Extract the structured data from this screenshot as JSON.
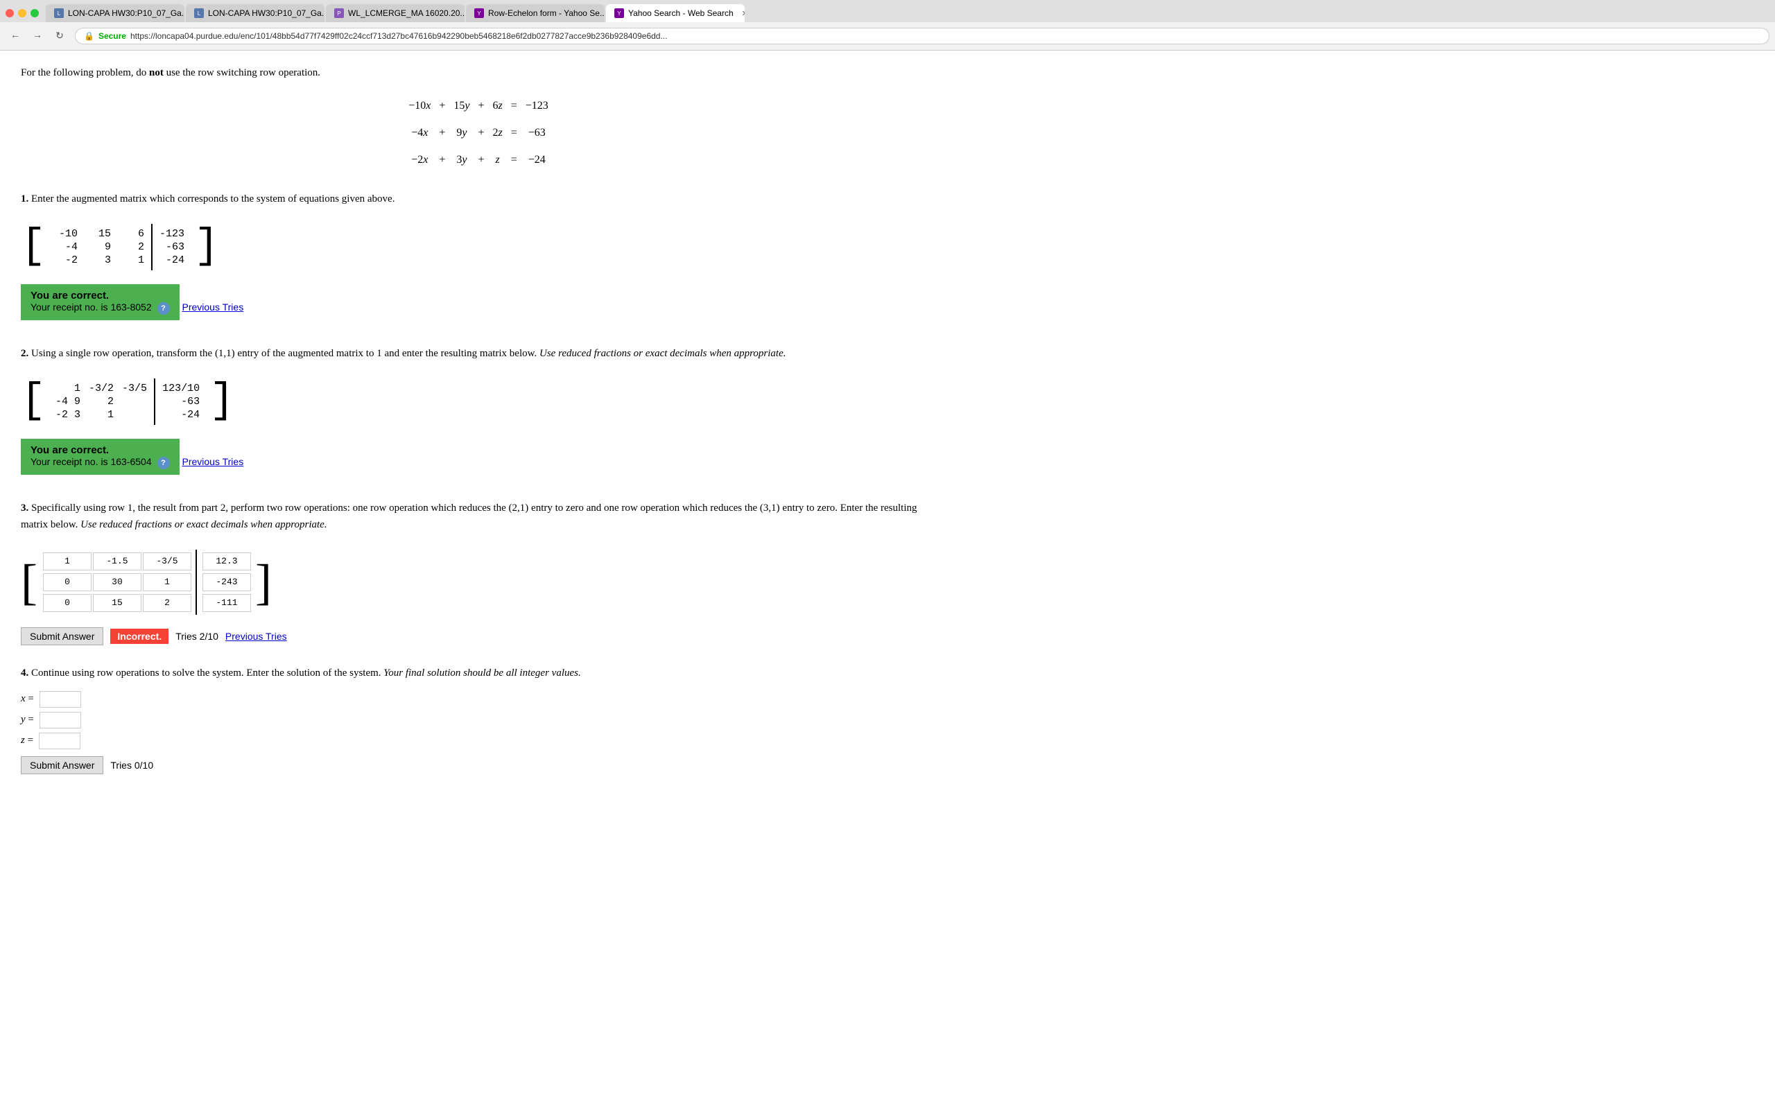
{
  "browser": {
    "tabs": [
      {
        "id": "tab1",
        "label": "LON-CAPA HW30:P10_07_Ga...",
        "active": false,
        "icon": "loncapa"
      },
      {
        "id": "tab2",
        "label": "LON-CAPA HW30:P10_07_Ga...",
        "active": false,
        "icon": "loncapa"
      },
      {
        "id": "tab3",
        "label": "WL_LCMERGE_MA 16020.20...",
        "active": false,
        "icon": "purple"
      },
      {
        "id": "tab4",
        "label": "Row-Echelon form - Yahoo Se...",
        "active": false,
        "icon": "yahoo"
      },
      {
        "id": "tab5",
        "label": "Yahoo Search - Web Search",
        "active": true,
        "icon": "yahoo"
      }
    ],
    "address": {
      "protocol": "Secure",
      "url": "https://loncapa04.purdue.edu/enc/101/48bb54d77f7429ff02c24ccf713d27bc47616b942290beb5468218e6f2db0277827acce9b236b928409e6dd..."
    }
  },
  "page": {
    "intro": "For the following problem, do not use the row switching row operation.",
    "system": {
      "eq1": [
        "-10x",
        "+",
        "15y",
        "+",
        "6z",
        "=",
        "-123"
      ],
      "eq2": [
        "-4x",
        "+",
        "9y",
        "+",
        "2z",
        "=",
        "-63"
      ],
      "eq3": [
        "-2x",
        "+",
        "3y",
        "+",
        "z",
        "=",
        "-24"
      ]
    },
    "q1": {
      "number": "1.",
      "text": "Enter the augmented matrix which corresponds to the system of equations given above.",
      "matrix": {
        "rows": [
          [
            "-10",
            "15",
            "6",
            "-123"
          ],
          [
            "-4",
            "9",
            "2",
            "-63"
          ],
          [
            "-2",
            "3",
            "1",
            "-24"
          ]
        ]
      },
      "status": "correct",
      "receipt": "Your receipt no. is 163-8052",
      "previous_tries": "Previous Tries"
    },
    "q2": {
      "number": "2.",
      "text": "Using a single row operation, transform the (1,1) entry of the augmented matrix to 1 and enter the resulting matrix below.",
      "text_italic": "Use reduced fractions or exact decimals when appropriate.",
      "matrix": {
        "rows": [
          [
            "1",
            "-3/2",
            "-3/5",
            "123/10"
          ],
          [
            "-4 9",
            "2",
            "-63"
          ],
          [
            "-2 3",
            "1",
            "-24"
          ]
        ]
      },
      "matrix_display": {
        "row1": [
          "1",
          "-3/2",
          "-3/5",
          "123/10"
        ],
        "row2": [
          "-4 9",
          "2",
          "-63"
        ],
        "row3": [
          "-2 3",
          "1",
          "-24"
        ]
      },
      "status": "correct",
      "receipt": "Your receipt no. is 163-6504",
      "previous_tries": "Previous Tries"
    },
    "q3": {
      "number": "3.",
      "text": "Specifically using row 1, the result from part 2, perform two row operations: one row operation which reduces the (2,1) entry to zero and one row operation which reduces the (3,1) entry to zero. Enter the resulting matrix below.",
      "text_italic": "Use reduced fractions or exact decimals when appropriate.",
      "matrix_values": {
        "row1": [
          "1",
          "-1.5",
          "-3/5",
          "12.3"
        ],
        "row2": [
          "0",
          "30",
          "1",
          "-243"
        ],
        "row3": [
          "0",
          "15",
          "2",
          "-111"
        ]
      },
      "status": "incorrect",
      "tries": "Tries 2/10",
      "previous_tries": "Previous Tries",
      "submit_label": "Submit Answer"
    },
    "q4": {
      "number": "4.",
      "text": "Continue using row operations to solve the system. Enter the solution of the system.",
      "text_italic": "Your final solution should be all integer values.",
      "x_label": "x =",
      "y_label": "y =",
      "z_label": "z =",
      "tries": "Tries 0/10",
      "submit_label": "Submit Answer"
    }
  }
}
